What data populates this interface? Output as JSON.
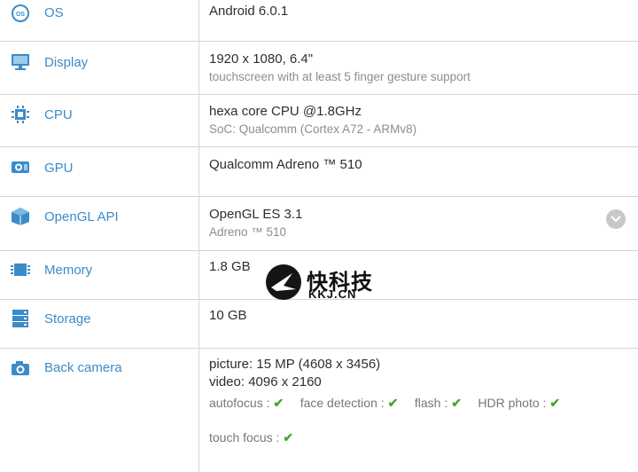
{
  "colors": {
    "label": "#3b8bc9",
    "primary_text": "#2e2e2e",
    "secondary_text": "#8d8d8d",
    "check": "#4aa52a",
    "divider": "#d4d4d4"
  },
  "rows": [
    {
      "label": "OS",
      "icon": "os-icon",
      "primary": "Android 6.0.1"
    },
    {
      "label": "Display",
      "icon": "monitor-icon",
      "primary": "1920 x 1080, 6.4\"",
      "secondary": "touchscreen with at least 5 finger gesture support"
    },
    {
      "label": "CPU",
      "icon": "chip-icon",
      "primary": "hexa core CPU @1.8GHz",
      "secondary": "SoC: Qualcomm (Cortex A72 - ARMv8)"
    },
    {
      "label": "GPU",
      "icon": "gpu-icon",
      "primary": "Qualcomm Adreno ™ 510"
    },
    {
      "label": "OpenGL API",
      "icon": "cube-icon",
      "primary": "OpenGL ES 3.1",
      "secondary": "Adreno ™ 510"
    },
    {
      "label": "Memory",
      "icon": "memory-icon",
      "primary": "1.8 GB"
    },
    {
      "label": "Storage",
      "icon": "storage-icon",
      "primary": "10 GB"
    },
    {
      "label": "Back camera",
      "icon": "camera-icon",
      "lines": [
        "picture: 15 MP (4608 x 3456)",
        "video: 4096 x 2160"
      ],
      "features": [
        "autofocus :",
        "face detection :",
        "flash :",
        "HDR photo :",
        "touch focus :"
      ]
    }
  ],
  "check_mark": "✔",
  "watermark": {
    "cn": "快科技",
    "en": "KKJ.CN"
  }
}
